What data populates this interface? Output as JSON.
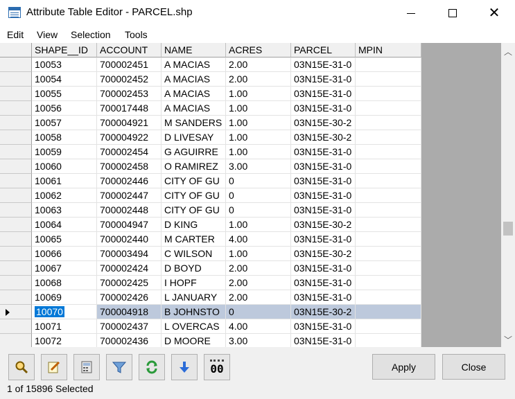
{
  "window": {
    "title": "Attribute Table Editor - PARCEL.shp",
    "controls": {
      "minimize": "minimize-icon",
      "maximize": "maximize-icon",
      "close": "close-icon"
    }
  },
  "menu": [
    "Edit",
    "View",
    "Selection",
    "Tools"
  ],
  "table": {
    "columns": [
      "SHAPE__ID",
      "ACCOUNT",
      "NAME",
      "ACRES",
      "PARCEL",
      "MPIN"
    ],
    "rows": [
      [
        "10053",
        "700002451",
        "A MACIAS",
        "2.00",
        "03N15E-31-0",
        ""
      ],
      [
        "10054",
        "700002452",
        "A MACIAS",
        "2.00",
        "03N15E-31-0",
        ""
      ],
      [
        "10055",
        "700002453",
        "A MACIAS",
        "1.00",
        "03N15E-31-0",
        ""
      ],
      [
        "10056",
        "700017448",
        "A MACIAS",
        "1.00",
        "03N15E-31-0",
        ""
      ],
      [
        "10057",
        "700004921",
        "M SANDERS",
        "1.00",
        "03N15E-30-2",
        ""
      ],
      [
        "10058",
        "700004922",
        "D LIVESAY",
        "1.00",
        "03N15E-30-2",
        ""
      ],
      [
        "10059",
        "700002454",
        "G AGUIRRE",
        "1.00",
        "03N15E-31-0",
        ""
      ],
      [
        "10060",
        "700002458",
        "O RAMIREZ",
        "3.00",
        "03N15E-31-0",
        ""
      ],
      [
        "10061",
        "700002446",
        "CITY OF GU",
        "0",
        "03N15E-31-0",
        ""
      ],
      [
        "10062",
        "700002447",
        "CITY OF GU",
        "0",
        "03N15E-31-0",
        ""
      ],
      [
        "10063",
        "700002448",
        "CITY OF GU",
        "0",
        "03N15E-31-0",
        ""
      ],
      [
        "10064",
        "700004947",
        "D KING",
        "1.00",
        "03N15E-30-2",
        ""
      ],
      [
        "10065",
        "700002440",
        "M CARTER",
        "4.00",
        "03N15E-31-0",
        ""
      ],
      [
        "10066",
        "700003494",
        "C WILSON",
        "1.00",
        "03N15E-30-2",
        ""
      ],
      [
        "10067",
        "700002424",
        "D BOYD",
        "2.00",
        "03N15E-31-0",
        ""
      ],
      [
        "10068",
        "700002425",
        "I HOPF",
        "2.00",
        "03N15E-31-0",
        ""
      ],
      [
        "10069",
        "700002426",
        "L JANUARY",
        "2.00",
        "03N15E-31-0",
        ""
      ],
      [
        "10070",
        "700004918",
        "B JOHNSTO",
        "0",
        "03N15E-30-2",
        ""
      ],
      [
        "10071",
        "700002437",
        "L OVERCAS",
        "4.00",
        "03N15E-31-0",
        ""
      ],
      [
        "10072",
        "700002436",
        "D MOORE",
        "3.00",
        "03N15E-31-0",
        ""
      ]
    ],
    "selected_row_index": 17
  },
  "toolbar": {
    "icons": [
      "zoom-icon",
      "edit-icon",
      "calculator-icon",
      "filter-icon",
      "refresh-icon",
      "move-down-icon",
      "field-icon"
    ],
    "field_icon_text": "00"
  },
  "buttons": {
    "apply": "Apply",
    "close": "Close"
  },
  "status": "1 of 15896 Selected",
  "colors": {
    "selected_row": "#bdc9dc",
    "selected_cell": "#0078d7",
    "grid_background": "#ababab"
  }
}
